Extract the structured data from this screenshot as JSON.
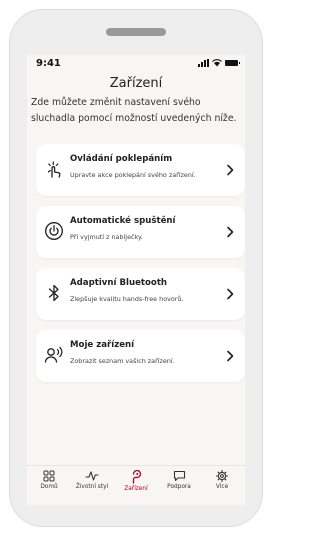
{
  "status_bar": {
    "time": "9:41",
    "icons": [
      "signal-icon",
      "wifi-icon",
      "battery-icon"
    ]
  },
  "header": {
    "title": "Zařízení"
  },
  "description": "Zde můžete změnit nastavení svého sluchadla pomocí možností uvedených níže.",
  "cards": [
    {
      "title": "Ovládání poklepáním",
      "subtitle": "Upravte akce poklepání svého zařízení.",
      "icon": "tap-icon"
    },
    {
      "title": "Automatické spuštění",
      "subtitle": "Při vyjmutí z nabíječky.",
      "icon": "power-icon"
    },
    {
      "title": "Adaptivní Bluetooth",
      "subtitle": "Zlepšuje kvalitu hands-free hovorů.",
      "icon": "bluetooth-icon"
    },
    {
      "title": "Moje zařízení",
      "subtitle": "Zobrazit seznam vašich zařízení.",
      "icon": "person-hearing-icon"
    }
  ],
  "tabs": [
    {
      "label": "Domů",
      "icon": "home-grid-icon",
      "active": false
    },
    {
      "label": "Životní styl",
      "icon": "pulse-icon",
      "active": false
    },
    {
      "label": "Zařízení",
      "icon": "hearing-aid-icon",
      "active": true
    },
    {
      "label": "Podpora",
      "icon": "chat-icon",
      "active": false
    },
    {
      "label": "Více",
      "icon": "gear-icon",
      "active": false
    }
  ],
  "colors": {
    "accent": "#b3001b",
    "card": "#ffffff",
    "screen_bg": "#f7f6f5",
    "frame": "#eeeeee"
  }
}
